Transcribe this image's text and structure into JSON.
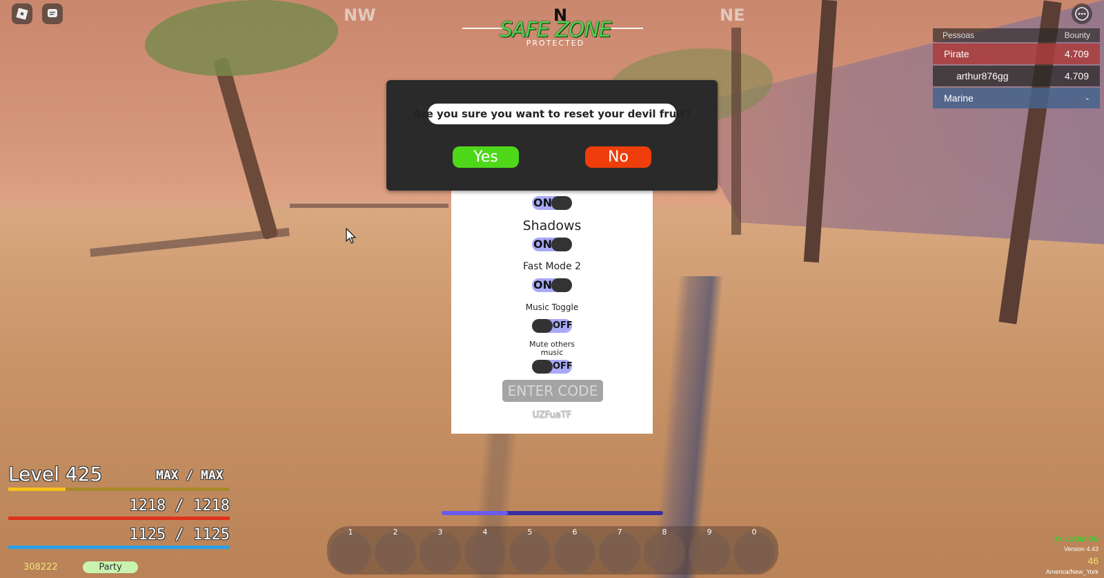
{
  "compass": {
    "nw": "NW",
    "n": "N",
    "ne": "NE"
  },
  "zone": {
    "title": "SAFE ZONE",
    "subtitle": "PROTECTED"
  },
  "leaderboard": {
    "header_left": "Pessoas",
    "header_right": "Bounty",
    "teams": [
      {
        "name": "Pirate",
        "value": "4.709"
      },
      {
        "name": "Marine",
        "value": "-"
      }
    ],
    "player": {
      "name": "arthur876gg",
      "value": "4.709"
    }
  },
  "dialog": {
    "question": "Are you sure you want to reset your devil fruit?",
    "yes": "Yes",
    "no": "No"
  },
  "settings": {
    "toggle1": "ON",
    "shadows_label": "Shadows",
    "shadows_state": "ON",
    "fastmode_label": "Fast Mode 2",
    "fastmode_state": "ON",
    "music_label": "Music Toggle",
    "music_state": "OFF",
    "mute_label_1": "Mute others",
    "mute_label_2": "music",
    "mute_state": "OFF",
    "code_placeholder": "ENTER CODE",
    "code_id": "UZFuaTF"
  },
  "hud": {
    "level": "Level 425",
    "xp": "MAX / MAX",
    "health": "1218 / 1218",
    "energy": "1125 / 1125",
    "money": "308222",
    "party": "Party",
    "xp_fraction": 0.26,
    "ability_fraction": 0.3,
    "colors": {
      "xp": "#f3c21a",
      "health": "#e0321a",
      "energy": "#2aa0e6"
    }
  },
  "hotbar": [
    "1",
    "2",
    "3",
    "4",
    "5",
    "6",
    "7",
    "8",
    "9",
    "0"
  ],
  "bottom_right": {
    "event": "2X LOGIA ON",
    "version": "Version 4.43",
    "fps": "46",
    "timezone": "America/New_York"
  },
  "icons": [
    "roblox-icon",
    "chat-icon",
    "menu-icon",
    "cursor-icon"
  ]
}
